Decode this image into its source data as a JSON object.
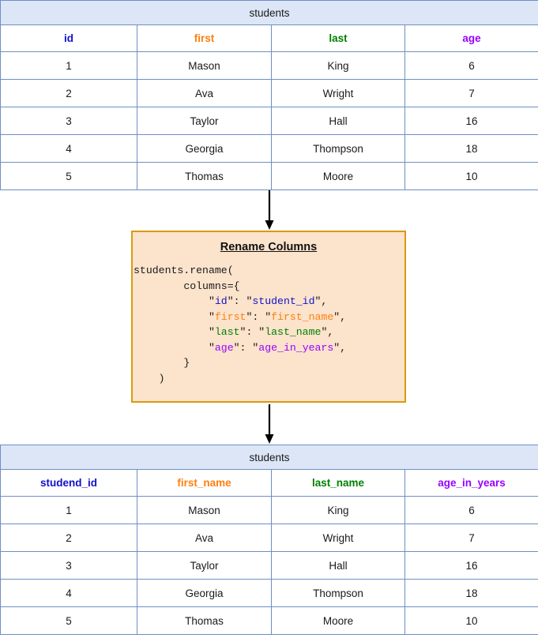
{
  "colors": {
    "table_border": "#6F8FC4",
    "table_title_bg": "#DCE6F7",
    "code_border": "#D99B10",
    "code_bg": "#FBE3CC",
    "col_id": "#1111CC",
    "col_first": "#FF7F0E",
    "col_last": "#008000",
    "col_age": "#9900FF",
    "arrow": "#000000"
  },
  "input_table": {
    "title": "students",
    "columns": [
      {
        "label": "id",
        "color_key": "col_id"
      },
      {
        "label": "first",
        "color_key": "col_first"
      },
      {
        "label": "last",
        "color_key": "col_last"
      },
      {
        "label": "age",
        "color_key": "col_age"
      }
    ],
    "rows": [
      [
        "1",
        "Mason",
        "King",
        "6"
      ],
      [
        "2",
        "Ava",
        "Wright",
        "7"
      ],
      [
        "3",
        "Taylor",
        "Hall",
        "16"
      ],
      [
        "4",
        "Georgia",
        "Thompson",
        "18"
      ],
      [
        "5",
        "Thomas",
        "Moore",
        "10"
      ]
    ]
  },
  "operation": {
    "title": "Rename Columns",
    "code_lines": [
      {
        "indent": 0,
        "segments": [
          {
            "text": "students.rename(",
            "color_key": null
          }
        ]
      },
      {
        "indent": 8,
        "segments": [
          {
            "text": "columns={",
            "color_key": null
          }
        ]
      },
      {
        "indent": 12,
        "segments": [
          {
            "text": "\"",
            "color_key": null
          },
          {
            "text": "id",
            "color_key": "col_id"
          },
          {
            "text": "\": \"",
            "color_key": null
          },
          {
            "text": "student_id",
            "color_key": "col_id"
          },
          {
            "text": "\",",
            "color_key": null
          }
        ]
      },
      {
        "indent": 12,
        "segments": [
          {
            "text": "\"",
            "color_key": null
          },
          {
            "text": "first",
            "color_key": "col_first"
          },
          {
            "text": "\": \"",
            "color_key": null
          },
          {
            "text": "first_name",
            "color_key": "col_first"
          },
          {
            "text": "\",",
            "color_key": null
          }
        ]
      },
      {
        "indent": 12,
        "segments": [
          {
            "text": "\"",
            "color_key": null
          },
          {
            "text": "last",
            "color_key": "col_last"
          },
          {
            "text": "\": \"",
            "color_key": null
          },
          {
            "text": "last_name",
            "color_key": "col_last"
          },
          {
            "text": "\",",
            "color_key": null
          }
        ]
      },
      {
        "indent": 12,
        "segments": [
          {
            "text": "\"",
            "color_key": null
          },
          {
            "text": "age",
            "color_key": "col_age"
          },
          {
            "text": "\": \"",
            "color_key": null
          },
          {
            "text": "age_in_years",
            "color_key": "col_age"
          },
          {
            "text": "\",",
            "color_key": null
          }
        ]
      },
      {
        "indent": 8,
        "segments": [
          {
            "text": "}",
            "color_key": null
          }
        ]
      },
      {
        "indent": 4,
        "segments": [
          {
            "text": ")",
            "color_key": null
          }
        ]
      }
    ]
  },
  "output_table": {
    "title": "students",
    "columns": [
      {
        "label": "studend_id",
        "color_key": "col_id"
      },
      {
        "label": "first_name",
        "color_key": "col_first"
      },
      {
        "label": "last_name",
        "color_key": "col_last"
      },
      {
        "label": "age_in_years",
        "color_key": "col_age"
      }
    ],
    "rows": [
      [
        "1",
        "Mason",
        "King",
        "6"
      ],
      [
        "2",
        "Ava",
        "Wright",
        "7"
      ],
      [
        "3",
        "Taylor",
        "Hall",
        "16"
      ],
      [
        "4",
        "Georgia",
        "Thompson",
        "18"
      ],
      [
        "5",
        "Thomas",
        "Moore",
        "10"
      ]
    ]
  },
  "arrows": [
    {
      "name": "arrow-input-to-operation"
    },
    {
      "name": "arrow-operation-to-output"
    }
  ]
}
